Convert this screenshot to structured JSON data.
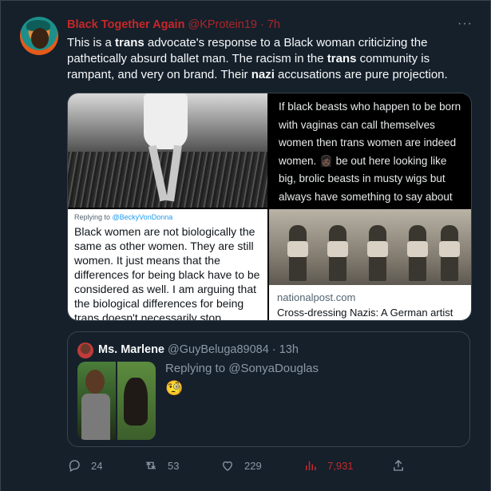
{
  "tweet": {
    "author_name": "Black Together Again",
    "author_handle": "@KProtein19",
    "separator": "·",
    "time": "7h",
    "more": "···",
    "text_parts": [
      "This is a ",
      "trans",
      " advocate's response to a Black woman criticizing the pathetically absurd ballet man. The racism in the ",
      "trans",
      " community is rampant, and very on brand. Their ",
      "nazi",
      " accusations are pure projection."
    ]
  },
  "media": {
    "top_right_text": "If black beasts who happen to be born with vaginas can call themselves women then trans women are indeed women. 👩🏿 be out here looking like big, brolic beasts  in musty wigs but always have something to say about trans",
    "reply_prefix": "Replying to ",
    "reply_handle": "@BeckyVonDonna",
    "bottom_left_text": "Black women are not biologically the same as other women. They are still women. It just means that the differences for being black have to be considered as well. I am arguing that the biological differences for being trans doesn't necessarily stop",
    "link_domain": "nationalpost.com",
    "link_caption": "Cross-dressing Nazis: A German artist"
  },
  "quote": {
    "name": "Ms. Marlene",
    "handle": "@GuyBeluga89084",
    "separator": "·",
    "time": "13h",
    "replying": "Replying to @SonyaDouglas",
    "emoji": "🧐"
  },
  "actions": {
    "replies": "24",
    "retweets": "53",
    "likes": "229",
    "views": "7,931"
  },
  "colors": {
    "background": "#15202b",
    "border": "#38444d",
    "muted": "#8b98a5",
    "author": "#c62828",
    "link": "#1d9bf0"
  }
}
